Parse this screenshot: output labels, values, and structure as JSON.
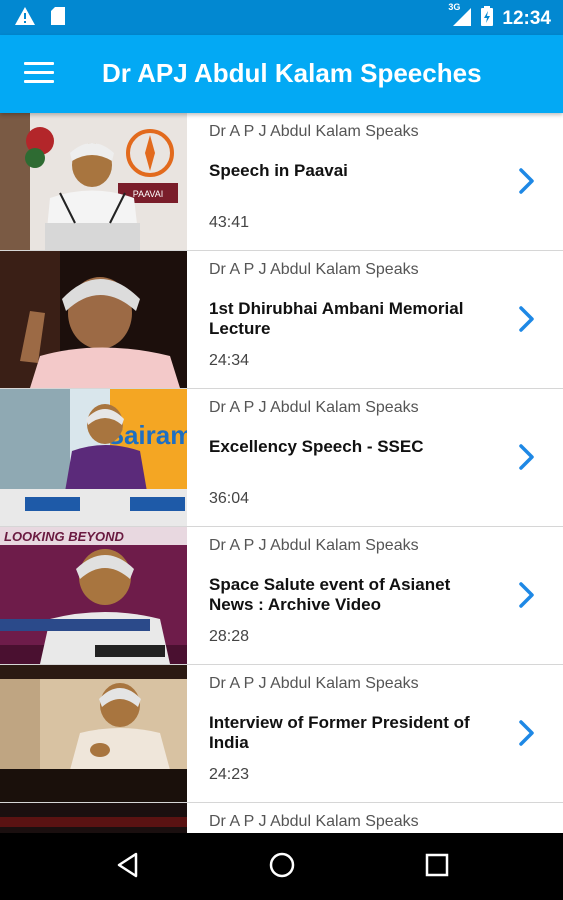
{
  "status_bar": {
    "time": "12:34",
    "network_label": "3G",
    "icons": [
      "warning-icon",
      "sd-card-icon",
      "signal-icon",
      "battery-icon"
    ]
  },
  "app_bar": {
    "title": "Dr APJ Abdul Kalam Speeches",
    "background": "#03a9f4",
    "status_color": "#0288d1"
  },
  "videos": [
    {
      "channel": "Dr A P J Abdul Kalam Speaks",
      "title": "Speech in Paavai",
      "duration": "43:41"
    },
    {
      "channel": "Dr A P J Abdul Kalam Speaks",
      "title": "1st Dhirubhai Ambani Memorial Lecture",
      "duration": "24:34"
    },
    {
      "channel": "Dr A P J Abdul Kalam Speaks",
      "title": "Excellency Speech - SSEC",
      "duration": "36:04"
    },
    {
      "channel": "Dr A P J Abdul Kalam Speaks",
      "title": "Space Salute event of Asianet News : Archive Video",
      "duration": "28:28"
    },
    {
      "channel": "Dr A P J Abdul Kalam Speaks",
      "title": "Interview of Former President of India",
      "duration": "24:23"
    },
    {
      "channel": "Dr A P J Abdul Kalam Speaks",
      "title": "",
      "duration": ""
    }
  ],
  "thumbnails": {
    "0": {
      "sign_text": "PAAVAI"
    },
    "2": {
      "sign_text": "Sairam"
    },
    "3": {
      "banner_text": "LOOKING BEYOND"
    }
  },
  "accent_color": "#1e88e5",
  "nav_bar": {
    "icons": [
      "back-icon",
      "home-icon",
      "recents-icon"
    ]
  }
}
